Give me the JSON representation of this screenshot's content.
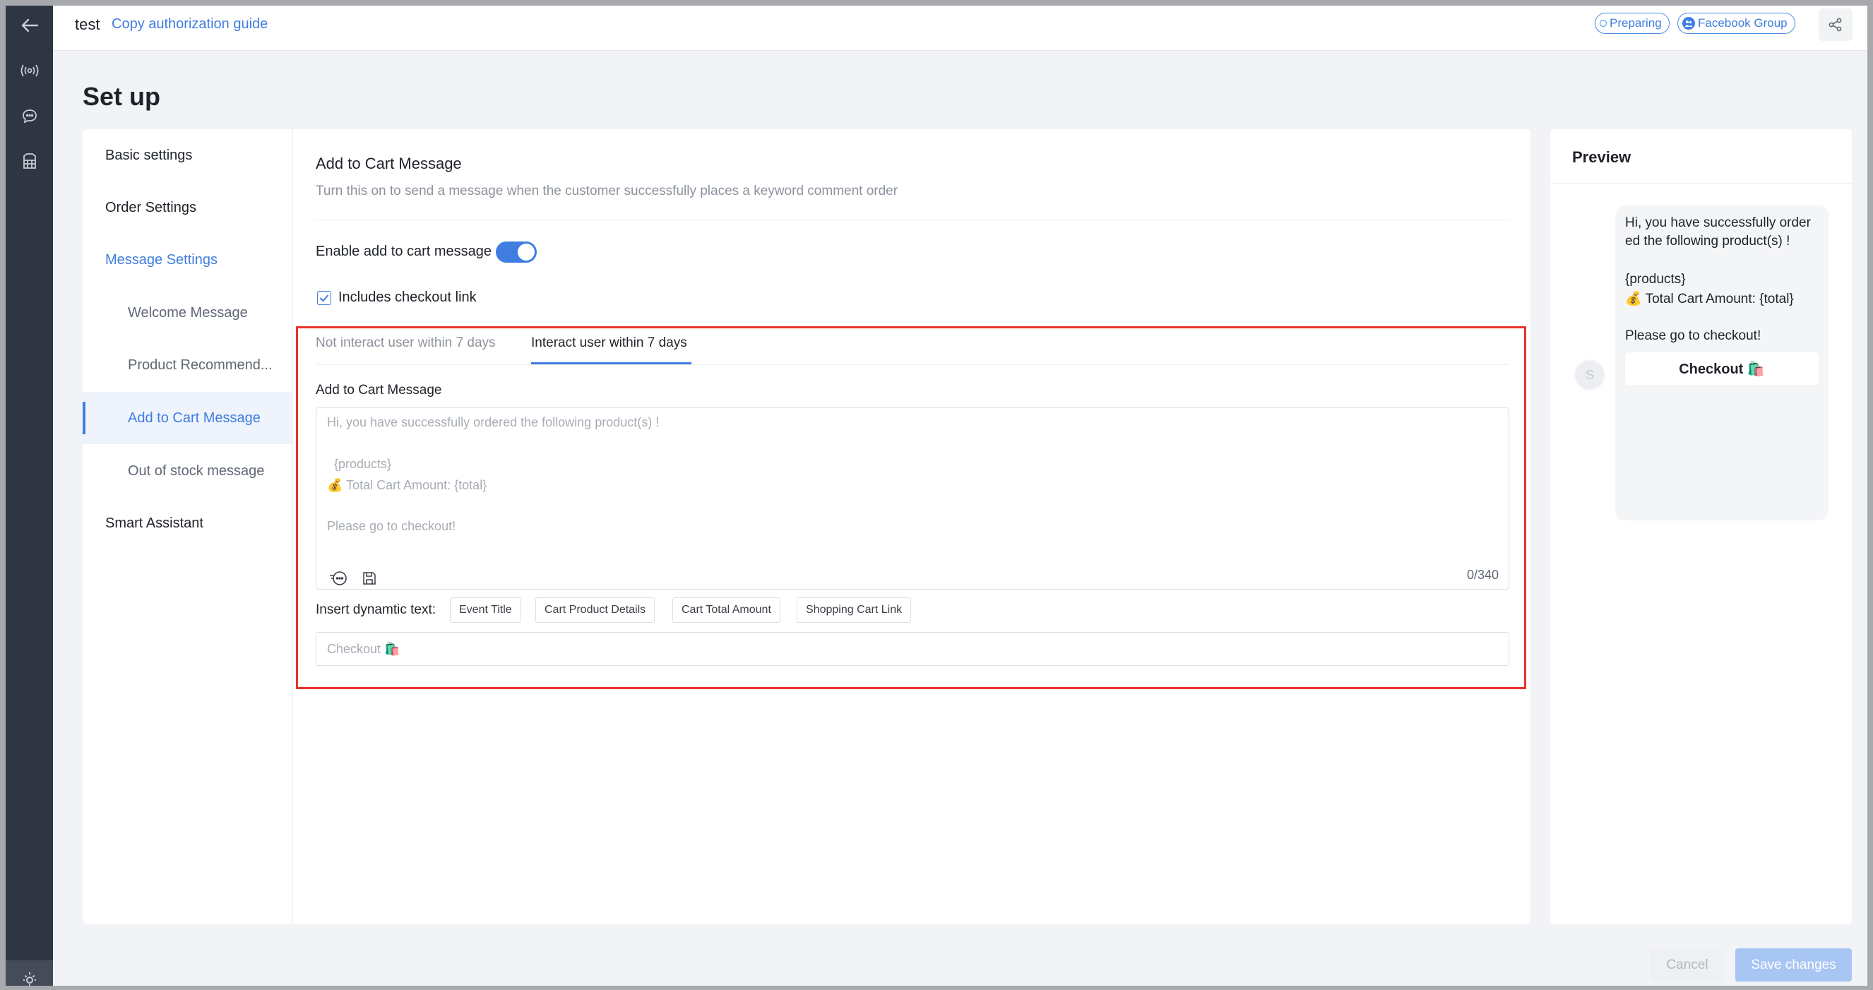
{
  "header": {
    "app_name": "test",
    "guide_link": "Copy authorization guide",
    "status_pill": "Preparing",
    "community_pill": "Facebook Group"
  },
  "page": {
    "title": "Set up"
  },
  "nav": {
    "basic": "Basic settings",
    "order": "Order Settings",
    "message": "Message Settings",
    "welcome": "Welcome Message",
    "product": "Product Recommend...",
    "cart": "Add to Cart Message",
    "stock": "Out of stock message",
    "assistant": "Smart Assistant"
  },
  "section": {
    "title": "Add to Cart Message",
    "description": "Turn this on to send a message when the customer successfully places a keyword comment order",
    "enable_label": "Enable add to cart message",
    "enable_state": true,
    "checkbox_label": "Includes checkout link",
    "checkbox_state": true
  },
  "tabs": {
    "not_interact": "Not interact user within 7 days",
    "interact": "Interact user within 7 days",
    "active": "interact"
  },
  "editor": {
    "label": "Add to Cart Message",
    "placeholder_line1": "Hi, you have successfully ordered the following product(s) !",
    "placeholder_line2": "  {products}",
    "placeholder_line3": "💰 Total Cart Amount: {total}",
    "placeholder_line4": "Please go to checkout!",
    "counter": "0/340",
    "emoji_icon": "emoji-icon",
    "save_icon": "save-icon"
  },
  "insert": {
    "label": "Insert dynamtic text:",
    "chips": [
      "Event Title",
      "Cart Product Details",
      "Cart Total Amount",
      "Shopping Cart Link"
    ]
  },
  "button_input": {
    "placeholder": "Checkout 🛍️"
  },
  "preview": {
    "title": "Preview",
    "avatar_initial": "S",
    "line1": "Hi, you have successfully order",
    "line2": "ed the following product(s) !",
    "line3": "{products}",
    "line4": "💰 Total Cart Amount: {total}",
    "line5": "Please go to checkout!",
    "checkout_button": "Checkout 🛍️"
  },
  "footer": {
    "cancel": "Cancel",
    "save": "Save changes"
  },
  "colors": {
    "accent": "#3f7de0",
    "highlight": "#e8332b",
    "rail": "#2f3543"
  }
}
